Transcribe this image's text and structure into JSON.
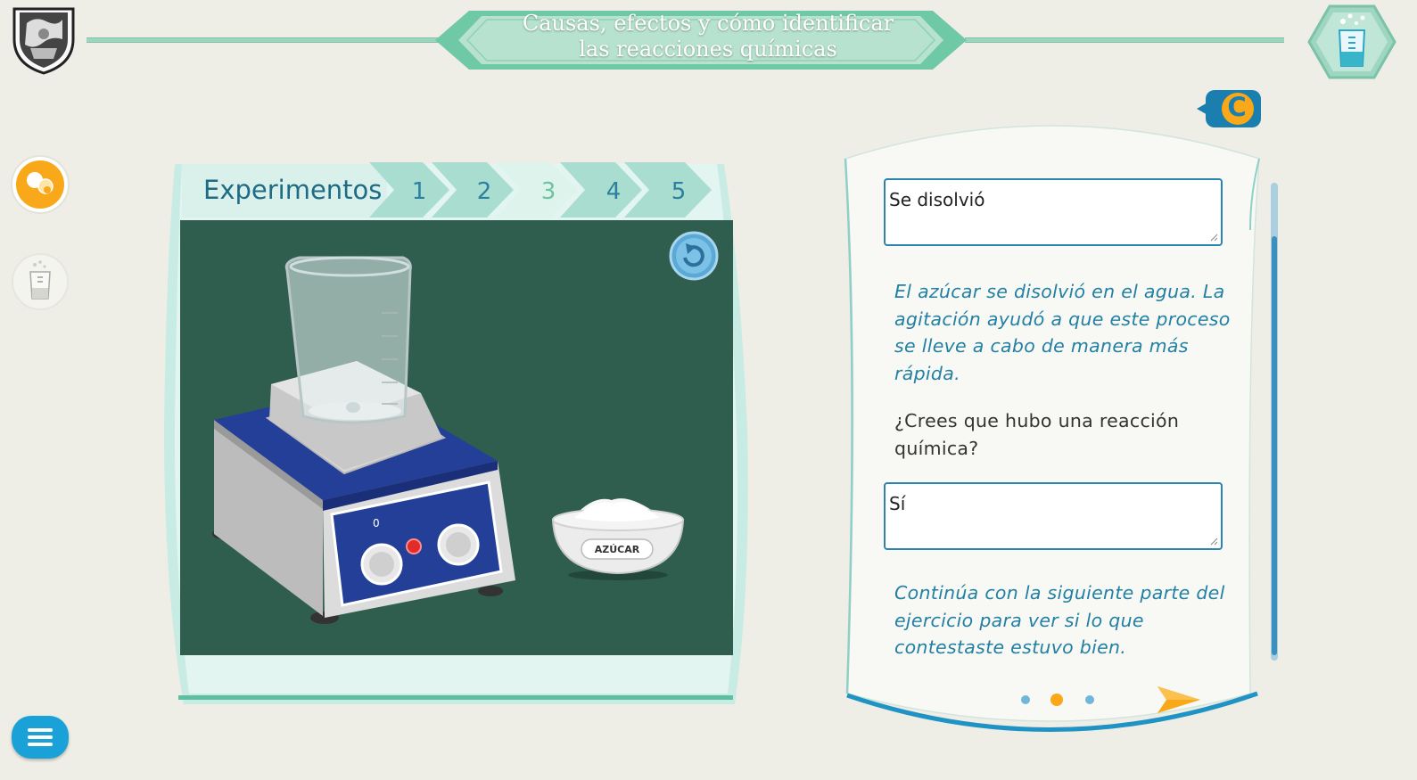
{
  "header": {
    "title_line1": "Causas, efectos y cómo identificar",
    "title_line2": "las reacciones químicas"
  },
  "sidebar": {
    "items": [
      {
        "icon": "bubbles-icon",
        "active": true
      },
      {
        "icon": "beaker-icon",
        "active": false
      }
    ],
    "menu_icon": "hamburger-menu-icon"
  },
  "experiments": {
    "label": "Experimentos",
    "tabs": [
      "1",
      "2",
      "3",
      "4",
      "5"
    ],
    "active_tab": "3",
    "bowl_label": "AZÚCAR",
    "dial_mark": "0"
  },
  "panel": {
    "badge": "C",
    "answer1": "Se disolvió",
    "feedback1": "El azúcar se disolvió en el agua. La agitación ayudó a que este proceso se lleve a cabo de manera más rápida.",
    "question": "¿Crees que hubo una reacción química?",
    "answer2": "Sí",
    "feedback2": "Continúa con la siguiente parte del ejercicio para ver si lo que contestaste estuvo bien.",
    "pagination": {
      "pages": 3,
      "current": 2
    }
  },
  "colors": {
    "accent_teal": "#7cc8ae",
    "active_orange": "#f8a818",
    "text_blue": "#2280a4",
    "stage_green": "#2f5e4f"
  }
}
